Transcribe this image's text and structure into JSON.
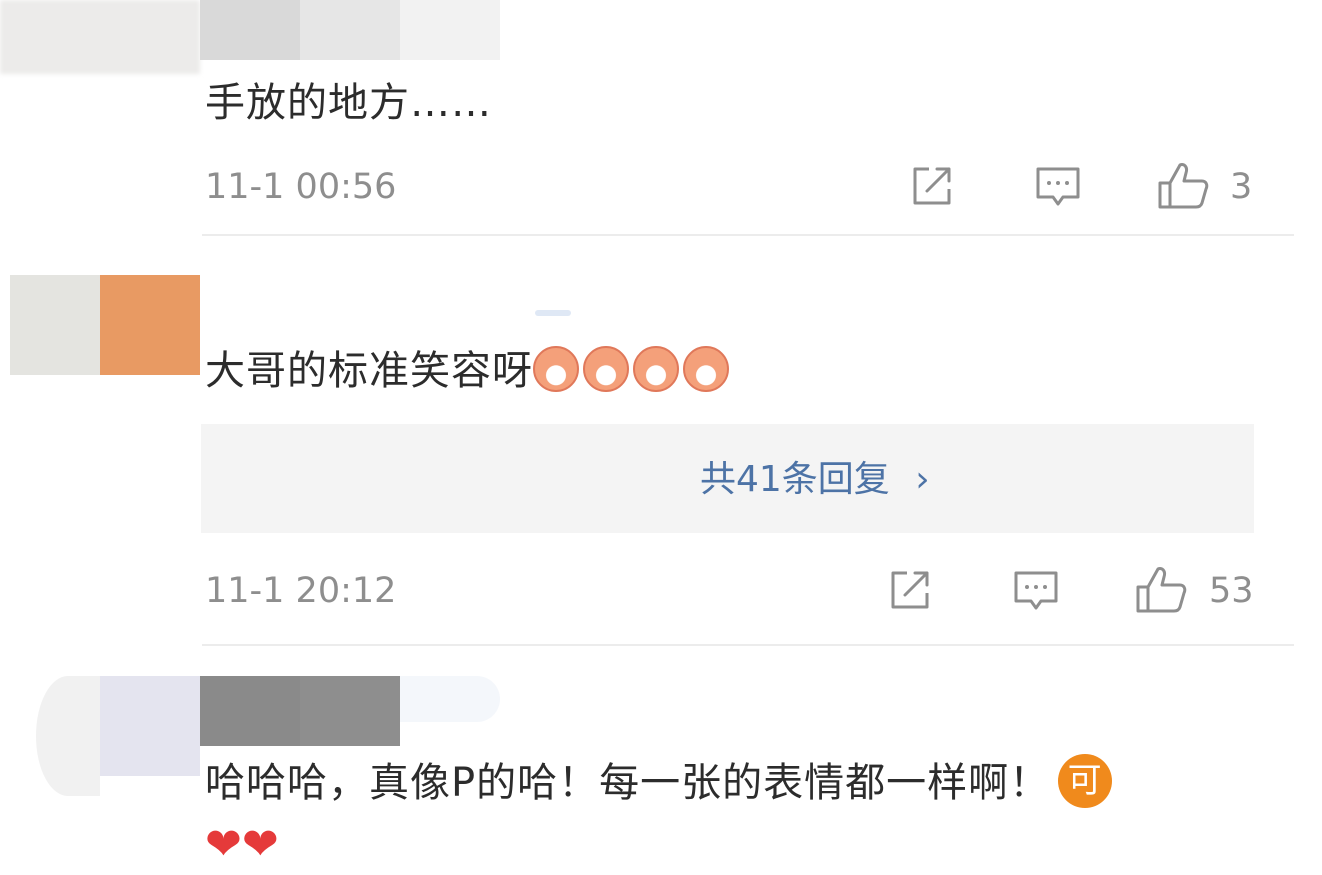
{
  "comments": [
    {
      "text": "手放的地方……",
      "time": "11-1 00:56",
      "likes": "3"
    },
    {
      "text": "大哥的标准笑容呀",
      "emoji_count": 4,
      "replies_label": "共41条回复",
      "replies_chevron": "›",
      "time": "11-1 20:12",
      "likes": "53"
    },
    {
      "text": "哈哈哈，真像P的哈！每一张的表情都一样啊！",
      "badge": "可",
      "hearts": "❤❤"
    }
  ],
  "icons": {
    "share": "share-icon",
    "comment": "comment-icon",
    "like": "thumbs-up-icon"
  },
  "colors": {
    "link": "#4d73a6",
    "meta_text": "#8e8e8e",
    "heart": "#e53a3a",
    "badge": "#f08a1c"
  }
}
